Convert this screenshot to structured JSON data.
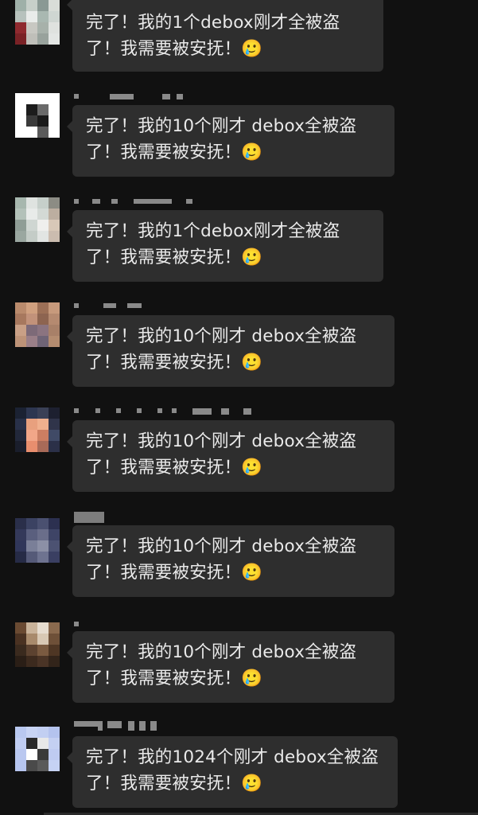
{
  "messages": [
    {
      "text": "完了！我的1个debox刚才全被盗了！我需要被安抚！🥲",
      "avatar_colors": [
        "#9fb0a8",
        "#c7cfc9",
        "#8a9994",
        "#d9ddd8",
        "#b7c2bd",
        "#e9ecea",
        "#a9b8b1",
        "#cfd6d2",
        "#8f2a2f",
        "#c8c8c2",
        "#a7b1aa",
        "#dfe2df",
        "#7a2226",
        "#bfbfb9",
        "#98a29c",
        "#e3e6e4"
      ]
    },
    {
      "text": "完了！我的10个刚才 debox全被盗了！我需要被安抚！🥲",
      "avatar_colors": [
        "#ffffff",
        "#ffffff",
        "#ffffff",
        "#ffffff",
        "#ffffff",
        "#1c1c1c",
        "#6a6a6a",
        "#ffffff",
        "#ffffff",
        "#3a3a3a",
        "#1a1a1a",
        "#ffffff",
        "#ffffff",
        "#ffffff",
        "#5a5a5a",
        "#ffffff"
      ]
    },
    {
      "text": "完了！我的1个debox刚才全被盗了！我需要被安抚！🥲",
      "avatar_colors": [
        "#a7b7ae",
        "#dfe3e0",
        "#c6cfca",
        "#8c8c84",
        "#b3c1b9",
        "#e8ebe9",
        "#d3d9d5",
        "#bcaea0",
        "#8f9d96",
        "#cfd6d2",
        "#efefed",
        "#d8c8b8",
        "#9aa7a0",
        "#c4ccc7",
        "#e2e5e3",
        "#cbbcaf"
      ]
    },
    {
      "text": "完了！我的10个刚才 debox全被盗了！我需要被安抚！🥲",
      "avatar_colors": [
        "#b98a6c",
        "#d0a07f",
        "#9c6f56",
        "#c79a7c",
        "#a7785e",
        "#c2927a",
        "#8d6450",
        "#b58a70",
        "#c9a086",
        "#7d6a78",
        "#8b7480",
        "#a88068",
        "#bd9378",
        "#9a7f88",
        "#6f6476",
        "#b48c70"
      ]
    },
    {
      "text": "完了！我的10个刚才 debox全被盗了！我需要被安抚！🥲",
      "avatar_colors": [
        "#1b2233",
        "#2d3650",
        "#3a4056",
        "#1d2030",
        "#283048",
        "#e8a07e",
        "#f0b08e",
        "#30344a",
        "#22283a",
        "#f2a688",
        "#cc7e62",
        "#404a66",
        "#1a1e2c",
        "#e88e6e",
        "#a86a58",
        "#2b3048"
      ]
    },
    {
      "text": "完了！我的10个刚才 debox全被盗了！我需要被安抚！🥲",
      "avatar_colors": [
        "#2a2f4a",
        "#3b4262",
        "#4a5070",
        "#2c3050",
        "#34395a",
        "#5a5f7e",
        "#6a6e8a",
        "#3e4466",
        "#30365a",
        "#7a7f98",
        "#8c90a6",
        "#4c5272",
        "#262b46",
        "#555a78",
        "#6e7390",
        "#3a3f62"
      ]
    },
    {
      "text": "完了！我的10个刚才 debox全被盗了！我需要被安抚！🥲",
      "avatar_colors": [
        "#6a4a32",
        "#c9b39a",
        "#e6dccf",
        "#8a6a4e",
        "#4a3222",
        "#a88a6c",
        "#d8c8b4",
        "#6e5038",
        "#3a2a1e",
        "#5c4230",
        "#7a5a40",
        "#4e3624",
        "#2a1e16",
        "#3c2a1e",
        "#4a3426",
        "#32241a"
      ]
    },
    {
      "text": "完了！我的1024个刚才 debox全被盗了！我需要被安抚！🥲",
      "avatar_colors": [
        "#b9c8f0",
        "#c8d4f4",
        "#c2cff2",
        "#b4c3ee",
        "#c0cdf2",
        "#2a2a2a",
        "#e8e8e8",
        "#c4d0f2",
        "#bac8f0",
        "#ffffff",
        "#3a3a3a",
        "#bfcbf1",
        "#b6c5ef",
        "#4a4a4a",
        "#5a5a5a",
        "#c6d2f4"
      ]
    }
  ]
}
